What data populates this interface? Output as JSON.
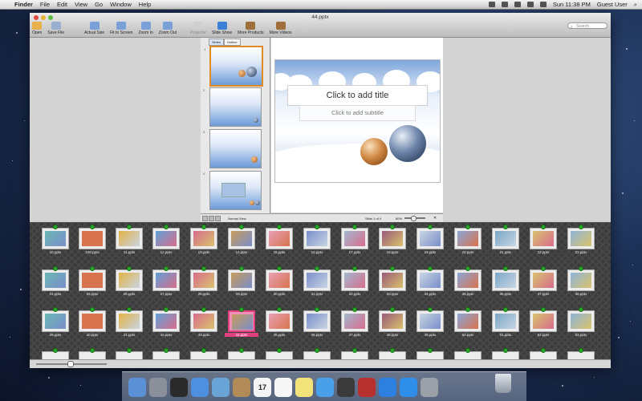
{
  "menubar": {
    "app_name": "Finder",
    "items": [
      "File",
      "Edit",
      "View",
      "Go",
      "Window",
      "Help"
    ],
    "clock": "Sun 11:38 PM",
    "user": "Guest User"
  },
  "window": {
    "title": "44.pptx",
    "toolbar": [
      {
        "label": "Open",
        "icon": "folder-open-icon",
        "enabled": true
      },
      {
        "label": "Save File",
        "icon": "save-file-icon",
        "enabled": true
      },
      {
        "label": "Actual Size",
        "icon": "actual-size-icon",
        "enabled": true
      },
      {
        "label": "Fit to Screen",
        "icon": "fit-to-screen-icon",
        "enabled": true
      },
      {
        "label": "Zoom In",
        "icon": "zoom-in-icon",
        "enabled": true
      },
      {
        "label": "Zoom Out",
        "icon": "zoom-out-icon",
        "enabled": true
      },
      {
        "label": "Projector",
        "icon": "projector-icon",
        "enabled": false
      },
      {
        "label": "Slide Show",
        "icon": "play-icon",
        "enabled": true
      },
      {
        "label": "More Products",
        "icon": "box-icon",
        "enabled": true
      },
      {
        "label": "More Videos",
        "icon": "box-icon",
        "enabled": true
      }
    ],
    "search_placeholder": "Search"
  },
  "editor": {
    "panel_tabs": [
      "Slides",
      "Outline"
    ],
    "thumb_numbers": [
      "1",
      "2",
      "3",
      "4"
    ],
    "slide_title": "Click to add title",
    "slide_subtitle": "Click to add subtitle",
    "view_label": "Normal View",
    "slide_counter": "Slide 1 of 4",
    "zoom": "80%"
  },
  "files": [
    "10.pptx",
    "100.pptx",
    "11.pptx",
    "12.pptx",
    "13.pptx",
    "14.pptx",
    "15.pptx",
    "16.pptx",
    "17.pptx",
    "18.pptx",
    "19.pptx",
    "20.pptx",
    "21.pptx",
    "22.pptx",
    "23.pptx",
    "24.pptx",
    "25.pptx",
    "26.pptx",
    "27.pptx",
    "28.pptx",
    "29.pptx",
    "30.pptx",
    "31.pptx",
    "32.pptx",
    "33.pptx",
    "34.pptx",
    "35.pptx",
    "36.pptx",
    "37.pptx",
    "38.pptx",
    "39.pptx",
    "40.pptx",
    "41.pptx",
    "42.pptx",
    "43.pptx",
    "44.pptx",
    "45.pptx",
    "46.pptx",
    "47.pptx",
    "48.pptx",
    "49.pptx",
    "50.pptx",
    "51.pptx",
    "52.pptx",
    "53.pptx"
  ],
  "selected_file": "44.pptx",
  "dock": [
    "finder-icon",
    "rocket-icon",
    "dashboard-icon",
    "safari-icon",
    "mail-icon",
    "address-book-icon",
    "calendar-icon",
    "reminders-icon",
    "notes-icon",
    "messages-icon",
    "facetime-icon",
    "photo-booth-icon",
    "itunes-icon",
    "app-store-icon",
    "preferences-icon"
  ],
  "dock_calendar_day": "17",
  "colors": {
    "accent": "#3478d8",
    "selection": "#e0407f",
    "pin": "#2aa92a"
  }
}
